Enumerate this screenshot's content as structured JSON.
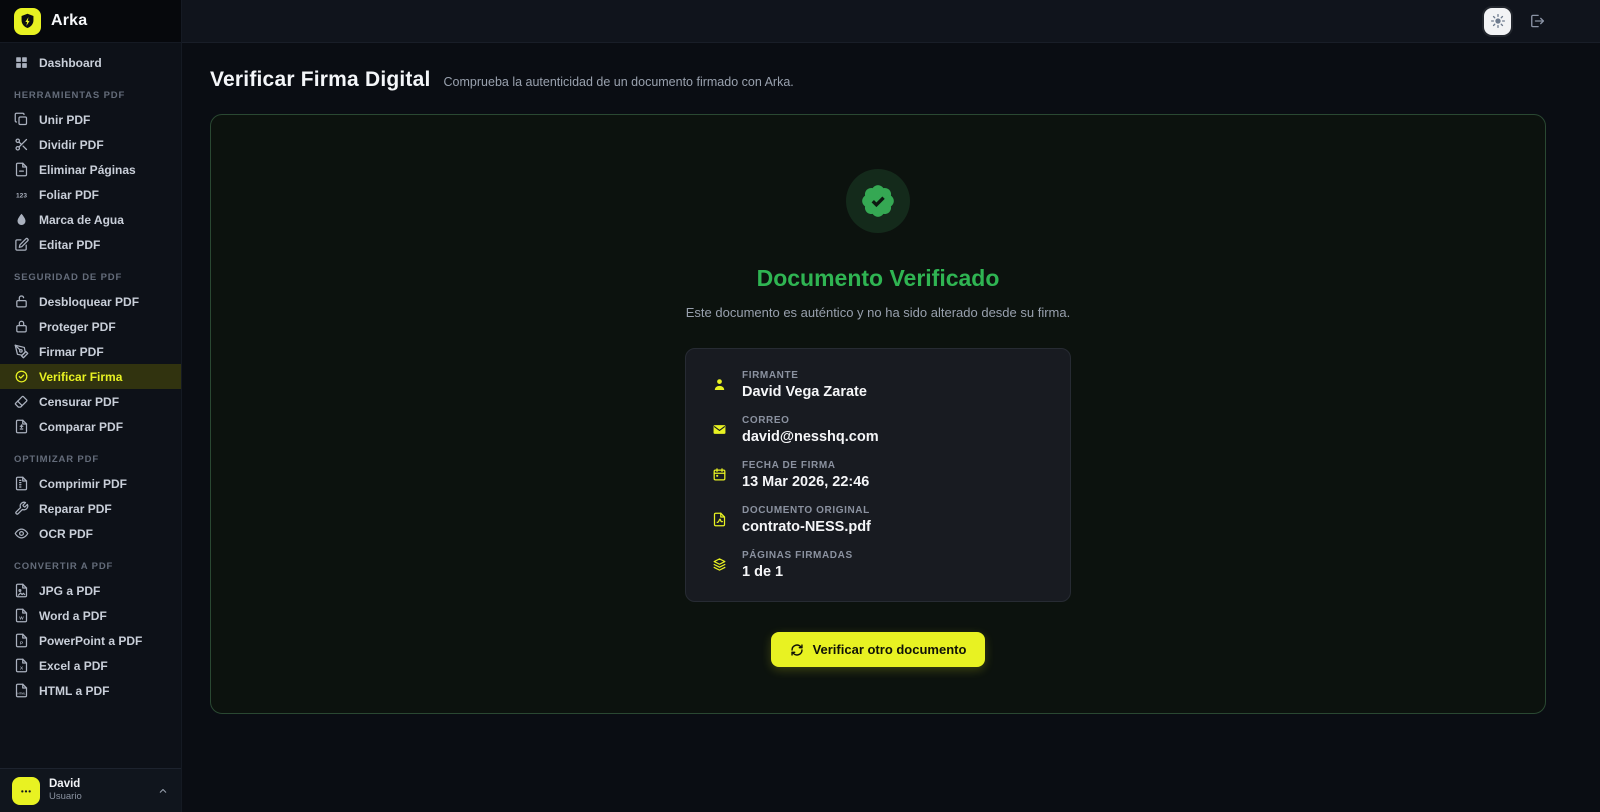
{
  "colors": {
    "accent_yellow": "#e8f222",
    "success_green": "#2fb452",
    "sidebar_active_bg": "#31330f"
  },
  "brand": {
    "name": "Arka",
    "logo_icon": "shield-bolt"
  },
  "topbar": {
    "theme_toggle_icon": "sun",
    "logout_icon": "logout"
  },
  "sidebar": {
    "dashboard": {
      "label": "Dashboard",
      "icon": "dashboard",
      "active": false
    },
    "sections": [
      {
        "title": "HERRAMIENTAS PDF",
        "items": [
          {
            "label": "Unir PDF",
            "icon": "copy",
            "active": false
          },
          {
            "label": "Dividir PDF",
            "icon": "scissors",
            "active": false
          },
          {
            "label": "Eliminar Páginas",
            "icon": "file-minus",
            "active": false
          },
          {
            "label": "Foliar PDF",
            "icon": "123",
            "active": false
          },
          {
            "label": "Marca de Agua",
            "icon": "droplet",
            "active": false
          },
          {
            "label": "Editar PDF",
            "icon": "edit",
            "active": false
          }
        ]
      },
      {
        "title": "SEGURIDAD DE PDF",
        "items": [
          {
            "label": "Desbloquear PDF",
            "icon": "unlock",
            "active": false
          },
          {
            "label": "Proteger PDF",
            "icon": "lock",
            "active": false
          },
          {
            "label": "Firmar PDF",
            "icon": "pen",
            "active": false
          },
          {
            "label": "Verificar Firma",
            "icon": "badge-check",
            "active": true
          },
          {
            "label": "Censurar PDF",
            "icon": "eraser",
            "active": false
          },
          {
            "label": "Comparar PDF",
            "icon": "file-diff",
            "active": false
          }
        ]
      },
      {
        "title": "OPTIMIZAR PDF",
        "items": [
          {
            "label": "Comprimir PDF",
            "icon": "file-zip",
            "active": false
          },
          {
            "label": "Reparar PDF",
            "icon": "wrench",
            "active": false
          },
          {
            "label": "OCR PDF",
            "icon": "eye",
            "active": false
          }
        ]
      },
      {
        "title": "CONVERTIR A PDF",
        "items": [
          {
            "label": "JPG a PDF",
            "icon": "file-image",
            "active": false
          },
          {
            "label": "Word a PDF",
            "icon": "file-word",
            "active": false
          },
          {
            "label": "PowerPoint a PDF",
            "icon": "file-ppt",
            "active": false
          },
          {
            "label": "Excel a PDF",
            "icon": "file-excel",
            "active": false
          },
          {
            "label": "HTML a PDF",
            "icon": "file-html",
            "active": false
          }
        ]
      }
    ],
    "user": {
      "name": "David",
      "role": "Usuario",
      "avatar_icon": "dots",
      "chevron_icon": "chevron-up"
    }
  },
  "page": {
    "title": "Verificar Firma Digital",
    "subtitle": "Comprueba la autenticidad de un documento firmado con Arka."
  },
  "result": {
    "seal_icon": "badge-check-seal",
    "status_title": "Documento Verificado",
    "status_message": "Este documento es auténtico y no ha sido alterado desde su firma.",
    "details": [
      {
        "label": "FIRMANTE",
        "value": "David Vega Zarate",
        "icon": "user"
      },
      {
        "label": "CORREO",
        "value": "david@nesshq.com",
        "icon": "mail"
      },
      {
        "label": "FECHA DE FIRMA",
        "value": "13 Mar 2026, 22:46",
        "icon": "calendar"
      },
      {
        "label": "DOCUMENTO ORIGINAL",
        "value": "contrato-NESS.pdf",
        "icon": "file-pdf"
      },
      {
        "label": "PÁGINAS FIRMADAS",
        "value": "1 de 1",
        "icon": "layers"
      }
    ],
    "action_button": {
      "label": "Verificar otro documento",
      "icon": "refresh"
    }
  }
}
